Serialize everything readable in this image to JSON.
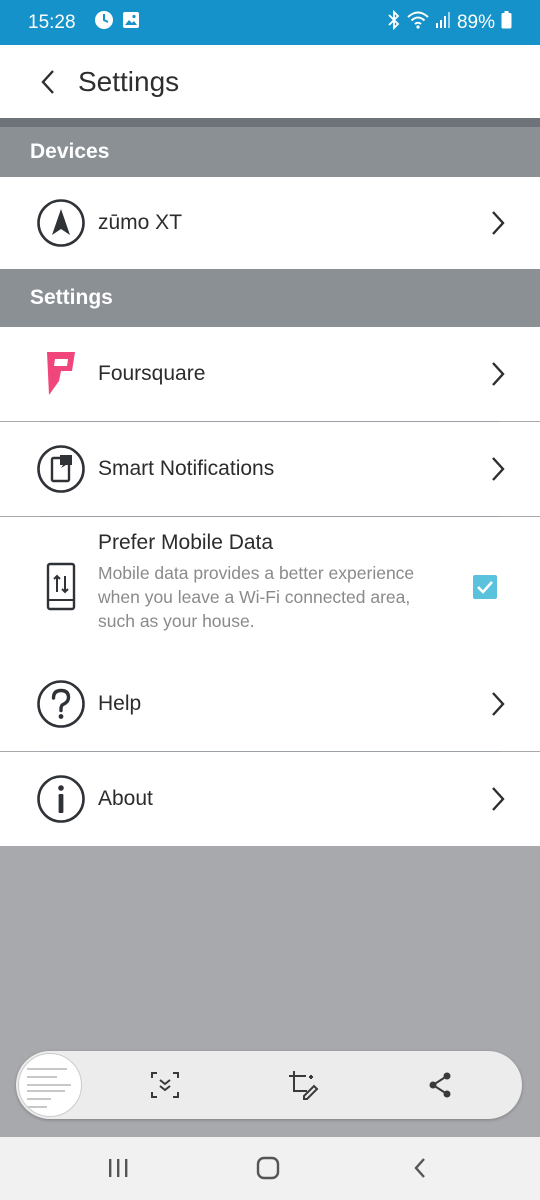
{
  "status_bar": {
    "time": "15:28",
    "battery": "89%",
    "left_icons": [
      "clock-icon",
      "gallery-icon"
    ],
    "right_icons": [
      "bluetooth-icon",
      "wifi-icon",
      "signal-icon",
      "battery-icon"
    ]
  },
  "app_bar": {
    "title": "Settings",
    "back_icon": "chevron-left-icon"
  },
  "sections": {
    "devices": {
      "header": "Devices",
      "items": [
        {
          "label": "zūmo XT",
          "icon": "navigation-arrow-icon"
        }
      ]
    },
    "settings": {
      "header": "Settings",
      "items": [
        {
          "label": "Foursquare",
          "icon": "foursquare-icon"
        },
        {
          "label": "Smart Notifications",
          "icon": "smart-notification-icon"
        },
        {
          "label": "Prefer Mobile Data",
          "description": "Mobile data provides a better experience when you leave a Wi-Fi connected area, such as your house.",
          "checked": true,
          "icon": "mobile-data-icon"
        },
        {
          "label": "Help",
          "icon": "help-icon"
        },
        {
          "label": "About",
          "icon": "info-icon"
        }
      ]
    }
  },
  "screenshot_toolbar": {
    "buttons": [
      "scroll-capture-icon",
      "crop-edit-icon",
      "share-icon"
    ]
  },
  "nav_bar": {
    "buttons": [
      "recents-icon",
      "home-icon",
      "back-icon"
    ]
  },
  "colors": {
    "status_bar": "#1592c9",
    "section_header": "#8b9095",
    "checkbox": "#5bc2dd",
    "foursquare": "#f0467b",
    "background": "#a8a9ad"
  }
}
